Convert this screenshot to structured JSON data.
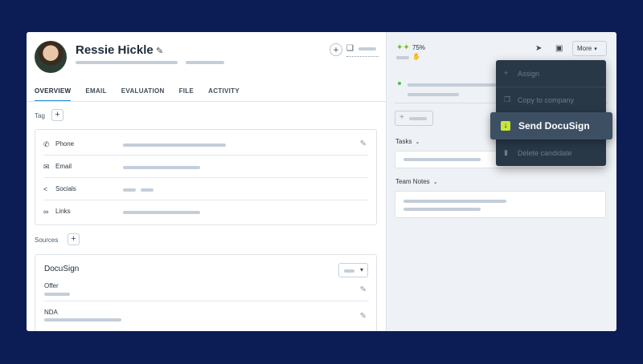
{
  "profile": {
    "name": "Ressie Hickle",
    "edit_icon": "pencil-icon",
    "add_icon": "plus-circle-icon",
    "bookmark_icon": "bookmark-icon"
  },
  "tabs": [
    {
      "label": "OVERVIEW",
      "active": true
    },
    {
      "label": "EMAIL",
      "active": false
    },
    {
      "label": "EVALUATION",
      "active": false
    },
    {
      "label": "FILE",
      "active": false
    },
    {
      "label": "ACTIVITY",
      "active": false
    }
  ],
  "tag": {
    "label": "Tag",
    "add": "+"
  },
  "contact_fields": [
    {
      "label": "Phone",
      "icon": "phone-icon",
      "glyph": "✆"
    },
    {
      "label": "Email",
      "icon": "mail-icon",
      "glyph": "✉"
    },
    {
      "label": "Socials",
      "icon": "share-icon",
      "glyph": "<"
    },
    {
      "label": "Links",
      "icon": "link-icon",
      "glyph": "∞"
    }
  ],
  "sources": {
    "label": "Sources",
    "add": "+",
    "card_title": "DocuSign",
    "rows": [
      {
        "label": "Offer"
      },
      {
        "label": "NDA"
      }
    ]
  },
  "right_panel": {
    "score": "75%",
    "score_icon": "thumbs-up-icon",
    "more_label": "More",
    "send_icon": "send-icon",
    "calendar_icon": "calendar-icon",
    "tasks_label": "Tasks",
    "team_notes_label": "Team Notes",
    "add": "+"
  },
  "more_menu": {
    "items": [
      {
        "label": "Assign",
        "icon": "plus-icon",
        "glyph": "+"
      },
      {
        "label": "Copy to company",
        "icon": "copy-icon",
        "glyph": "❐"
      },
      {
        "label": "Send DocuSign",
        "icon": "download-icon",
        "glyph": "↓",
        "highlighted": true
      },
      {
        "label": "Delete candidate",
        "icon": "trash-icon",
        "glyph": "▮"
      }
    ]
  },
  "colors": {
    "background": "#0c1c55",
    "accent": "#1d8fd6",
    "highlight_icon": "#c8e63a",
    "status_green": "#46c33a"
  }
}
